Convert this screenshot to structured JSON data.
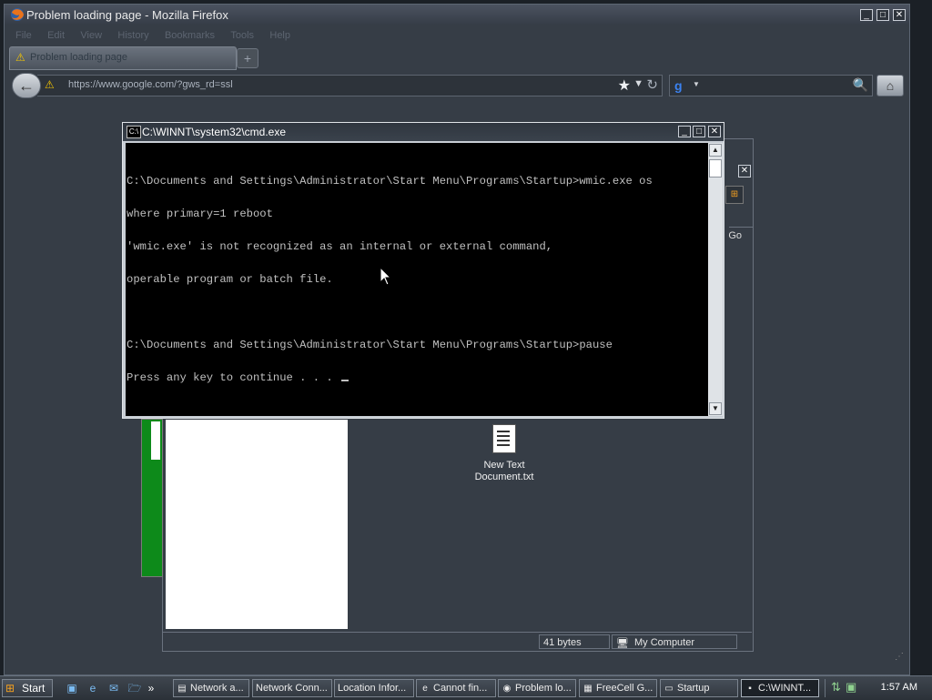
{
  "firefox": {
    "window_title": "Problem loading page - Mozilla Firefox",
    "menu": [
      "File",
      "Edit",
      "View",
      "History",
      "Bookmarks",
      "Tools",
      "Help"
    ],
    "tab_label": "Problem loading page",
    "new_tab": "+",
    "url": "https://www.google.com/?gws_rd=ssl",
    "search_engine": "g",
    "icons": [
      "firefox-logo-icon",
      "warning-icon",
      "back-arrow-icon",
      "star-icon",
      "dropdown-arrow-icon",
      "reload-icon",
      "google-icon",
      "search-icon",
      "home-icon"
    ]
  },
  "cmd": {
    "title": "C:\\WINNT\\system32\\cmd.exe",
    "lines": [
      "C:\\Documents and Settings\\Administrator\\Start Menu\\Programs\\Startup>wmic.exe os",
      "where primary=1 reboot",
      "'wmic.exe' is not recognized as an internal or external command,",
      "operable program or batch file.",
      "",
      "C:\\Documents and Settings\\Administrator\\Start Menu\\Programs\\Startup>pause",
      "Press any key to continue . . . "
    ]
  },
  "explorer": {
    "go_label": "Go",
    "desktop_item": "New Text Document.txt",
    "status_size": "41 bytes",
    "status_zone": "My Computer"
  },
  "taskbar": {
    "start_label": "Start",
    "tasks": [
      {
        "label": "Network a...",
        "icon": "network-icon"
      },
      {
        "label": "Network Conn...",
        "icon": "network-icon"
      },
      {
        "label": "Location Infor...",
        "icon": "folder-icon"
      },
      {
        "label": "Cannot fin...",
        "icon": "ie-icon"
      },
      {
        "label": "Problem lo...",
        "icon": "firefox-icon"
      },
      {
        "label": "FreeCell G...",
        "icon": "cards-icon"
      },
      {
        "label": "Startup",
        "icon": "folder-icon"
      },
      {
        "label": "C:\\WINNT...",
        "icon": "cmd-icon"
      }
    ],
    "clock": "1:57 AM"
  }
}
